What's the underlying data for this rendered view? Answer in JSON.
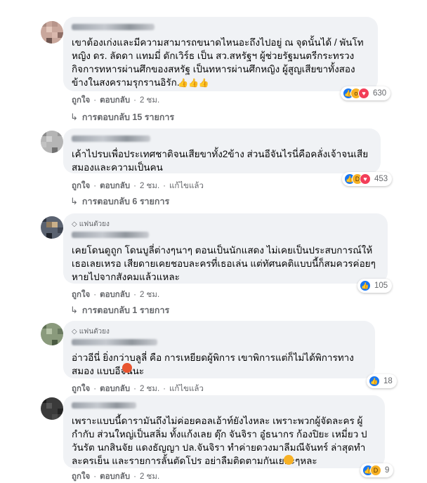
{
  "comments": [
    {
      "badge": "",
      "text": "เขาต้องเก่งและมีความสามารถขนาดไหนอะถึงไปอยู่ ณ จุดนั้นได้ / พันโทหญิง ดร. ลัดดา แทมมี่ ดักเวิร์ธ เป็น สว.สหรัฐฯ ผู้ช่วยรัฐมนตรีกระทรวงกิจการทหารผ่านศึกของสหรัฐ เป็นทหารผ่านศึกหญิง ผู้สูญเสียขาทั้งสองข้างในสงครามรุกรานอิรัก..",
      "actions": {
        "like": "ถูกใจ",
        "reply": "ตอบกลับ",
        "time": "2 ชม.",
        "edited": ""
      },
      "reactions": {
        "icons": [
          "like-reaction",
          "wow-reaction",
          "love-reaction"
        ],
        "count": "630"
      },
      "replies": "การตอบกลับ 15 รายการ"
    },
    {
      "badge": "",
      "text": "เค้าไปรบเพื่อประเทศชาติจนเสียขาทั้ง2ข้าง ส่วนอีจันไรนี่คือคลั่งเจ้าจนเสียสมองและความเป็นคน",
      "actions": {
        "like": "ถูกใจ",
        "reply": "ตอบกลับ",
        "time": "2 ชม.",
        "edited": "แก้ไขแล้ว"
      },
      "reactions": {
        "icons": [
          "like-reaction",
          "haha-reaction",
          "love-reaction"
        ],
        "count": "453"
      },
      "replies": "การตอบกลับ 6 รายการ"
    },
    {
      "badge": "แฟนตัวยง",
      "text": "เคยโดนดูถูก โดนบูลี่ต่างๆนาๆ ตอนเป็นนักแสดง ไม่เคยเป็นประสบการณ์ให้เธอเลยเหรอ เสียดายเคยชอบละครที่เธอเล่น แต่ทัศนคติแบบนี้ก็สมควรค่อยๆหายไปจากสังคมแล้วแหละ",
      "actions": {
        "like": "ถูกใจ",
        "reply": "ตอบกลับ",
        "time": "2 ชม.",
        "edited": ""
      },
      "reactions": {
        "icons": [
          "like-reaction"
        ],
        "count": "105"
      },
      "replies": "การตอบกลับ 1 รายการ"
    },
    {
      "badge": "แฟนตัวยง",
      "text": "อ่าวอีนี่ ยิ่งกว่าบลูลี่ คือ การเหยียดผู้พิการ เขาพิการแต่ก็ไม่ได้พิการทางสมอง แบบอีจันนะ",
      "actions": {
        "like": "ถูกใจ",
        "reply": "ตอบกลับ",
        "time": "2 ชม.",
        "edited": "แก้ไขแล้ว"
      },
      "reactions": {
        "icons": [
          "like-reaction"
        ],
        "count": "18"
      },
      "replies": ""
    },
    {
      "badge": "",
      "text": "เพราะแบบนี้ดารามันถึงไม่ค่อยคอลเอ้าท์ยังไงหละ เพราะพวกผู้จัดละคร ผู้กำกับ ส่วนใหญ่เป็นสลิ่ม ทั้งแก้งเลย ตุ๊ก จันจิรา อู๋ธนากร ก้องปิยะ เหมี่ยว ปวันรัต นกสินจัย แดงธัญญา ปล.จันจิรา ทำค่ายดวงมาลีมณีจันทร์ ล่าสุดทำละครเย็น และรายการลั้นตัดโปร อย่าลืมติดตามกันเยอะๆหละ",
      "actions": {
        "like": "ถูกใจ",
        "reply": "ตอบกลับ",
        "time": "2 ชม.",
        "edited": ""
      },
      "reactions": {
        "icons": [
          "like-reaction",
          "haha-reaction"
        ],
        "count": "9"
      },
      "replies": ""
    }
  ]
}
